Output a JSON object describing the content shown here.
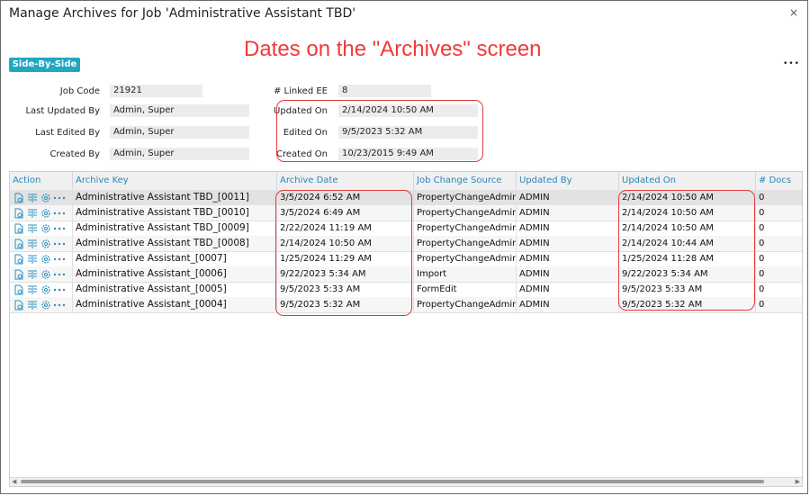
{
  "window": {
    "title": "Manage Archives for Job 'Administrative Assistant TBD'",
    "close_glyph": "×"
  },
  "headline": "Dates on the \"Archives\" screen",
  "toolbar": {
    "side_by_side_label": "Side-By-Side",
    "more_glyph": "•••"
  },
  "info": {
    "job_code_label": "Job Code",
    "job_code": "21921",
    "last_updated_by_label": "Last Updated By",
    "last_updated_by": "Admin, Super",
    "last_edited_by_label": "Last Edited By",
    "last_edited_by": "Admin, Super",
    "created_by_label": "Created By",
    "created_by": "Admin, Super",
    "linked_ee_label": "# Linked EE",
    "linked_ee": "8",
    "updated_on_label": "Updated On",
    "updated_on": "2/14/2024 10:50 AM",
    "edited_on_label": "Edited On",
    "edited_on": "9/5/2023 5:32 AM",
    "created_on_label": "Created On",
    "created_on": "10/23/2015 9:49 AM"
  },
  "grid": {
    "columns": [
      "Action",
      "Archive Key",
      "Archive Date",
      "Job Change Source",
      "Updated By",
      "Updated On",
      "# Docs"
    ],
    "rows": [
      [
        "Administrative Assistant TBD_[0011]",
        "3/5/2024 6:52 AM",
        "PropertyChangeAdmin",
        "ADMIN",
        "2/14/2024 10:50 AM",
        "0"
      ],
      [
        "Administrative Assistant TBD_[0010]",
        "3/5/2024 6:49 AM",
        "PropertyChangeAdmin",
        "ADMIN",
        "2/14/2024 10:50 AM",
        "0"
      ],
      [
        "Administrative Assistant TBD_[0009]",
        "2/22/2024 11:19 AM",
        "PropertyChangeAdmin",
        "ADMIN",
        "2/14/2024 10:50 AM",
        "0"
      ],
      [
        "Administrative Assistant TBD_[0008]",
        "2/14/2024 10:50 AM",
        "PropertyChangeAdmin",
        "ADMIN",
        "2/14/2024 10:44 AM",
        "0"
      ],
      [
        "Administrative Assistant_[0007]",
        "1/25/2024 11:29 AM",
        "PropertyChangeAdmin",
        "ADMIN",
        "1/25/2024 11:28 AM",
        "0"
      ],
      [
        "Administrative Assistant_[0006]",
        "9/22/2023 5:34 AM",
        "Import",
        "ADMIN",
        "9/22/2023 5:34 AM",
        "0"
      ],
      [
        "Administrative Assistant_[0005]",
        "9/5/2023 5:33 AM",
        "FormEdit",
        "ADMIN",
        "9/5/2023 5:33 AM",
        "0"
      ],
      [
        "Administrative Assistant_[0004]",
        "9/5/2023 5:32 AM",
        "PropertyChangeAdmin",
        "ADMIN",
        "9/5/2023 5:32 AM",
        "0"
      ]
    ],
    "action_icons": [
      "view-icon",
      "compare-icon",
      "settings-icon",
      "more-icon"
    ]
  },
  "colors": {
    "accent": "#22a7c3",
    "header_text": "#2a87b8",
    "highlight_red": "#e03b3b"
  }
}
